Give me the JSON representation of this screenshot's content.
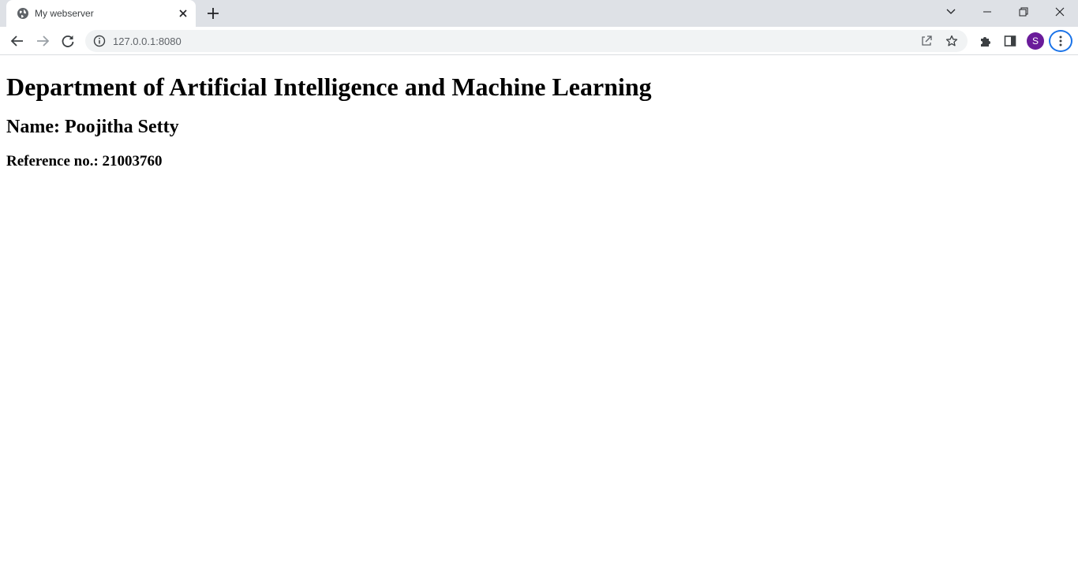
{
  "browser": {
    "tab": {
      "title": "My webserver",
      "favicon": "globe-icon"
    },
    "address_bar": {
      "url": "127.0.0.1:8080",
      "site_info_icon": "info-icon"
    },
    "profile": {
      "initial": "S",
      "color": "#6a1b9a"
    },
    "accent_color": "#1a73e8",
    "icons": {
      "back": "arrow-left-icon",
      "forward": "arrow-right-icon",
      "reload": "reload-icon",
      "share": "share-icon",
      "bookmark": "star-icon",
      "extensions": "puzzle-icon",
      "side_panel": "side-panel-icon",
      "menu": "kebab-menu-icon",
      "tab_search": "chevron-down-icon",
      "minimize": "minimize-icon",
      "restore": "restore-icon",
      "close": "close-icon"
    }
  },
  "page": {
    "heading": "Department of Artificial Intelligence and Machine Learning",
    "name": "Name: Poojitha Setty",
    "reference": "Reference no.: 21003760"
  }
}
